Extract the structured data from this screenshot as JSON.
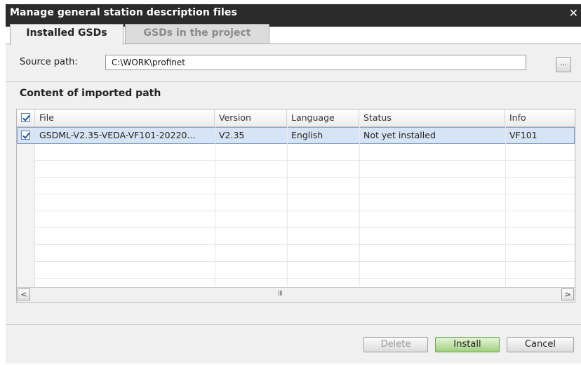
{
  "window": {
    "title": "Manage general station description files",
    "close_glyph": "✕"
  },
  "tabs": [
    {
      "label": "Installed GSDs",
      "active": true
    },
    {
      "label": "GSDs in the project",
      "active": false
    }
  ],
  "source": {
    "label": "Source path:",
    "value": "C:\\WORK\\profinet",
    "browse_label": "..."
  },
  "content": {
    "title": "Content of imported path",
    "columns": [
      "File",
      "Version",
      "Language",
      "Status",
      "Info"
    ],
    "header_checked": true,
    "rows": [
      {
        "checked": true,
        "file": "GSDML-V2.35-VEDA-VF101-20220...",
        "version": "V2.35",
        "language": "English",
        "status": "Not yet installed",
        "info": "VF101"
      }
    ],
    "scroll": {
      "left_glyph": "<",
      "right_glyph": ">",
      "grip_glyph": "III"
    }
  },
  "buttons": {
    "delete": "Delete",
    "install": "Install",
    "cancel": "Cancel"
  },
  "colors": {
    "selection": "#d7e4f7",
    "install_accent": "#9fd07c",
    "titlebar": "#2b2b2b"
  },
  "icons": [
    "close-icon",
    "checkbox-checked-icon",
    "scroll-left-icon",
    "scroll-right-icon"
  ]
}
